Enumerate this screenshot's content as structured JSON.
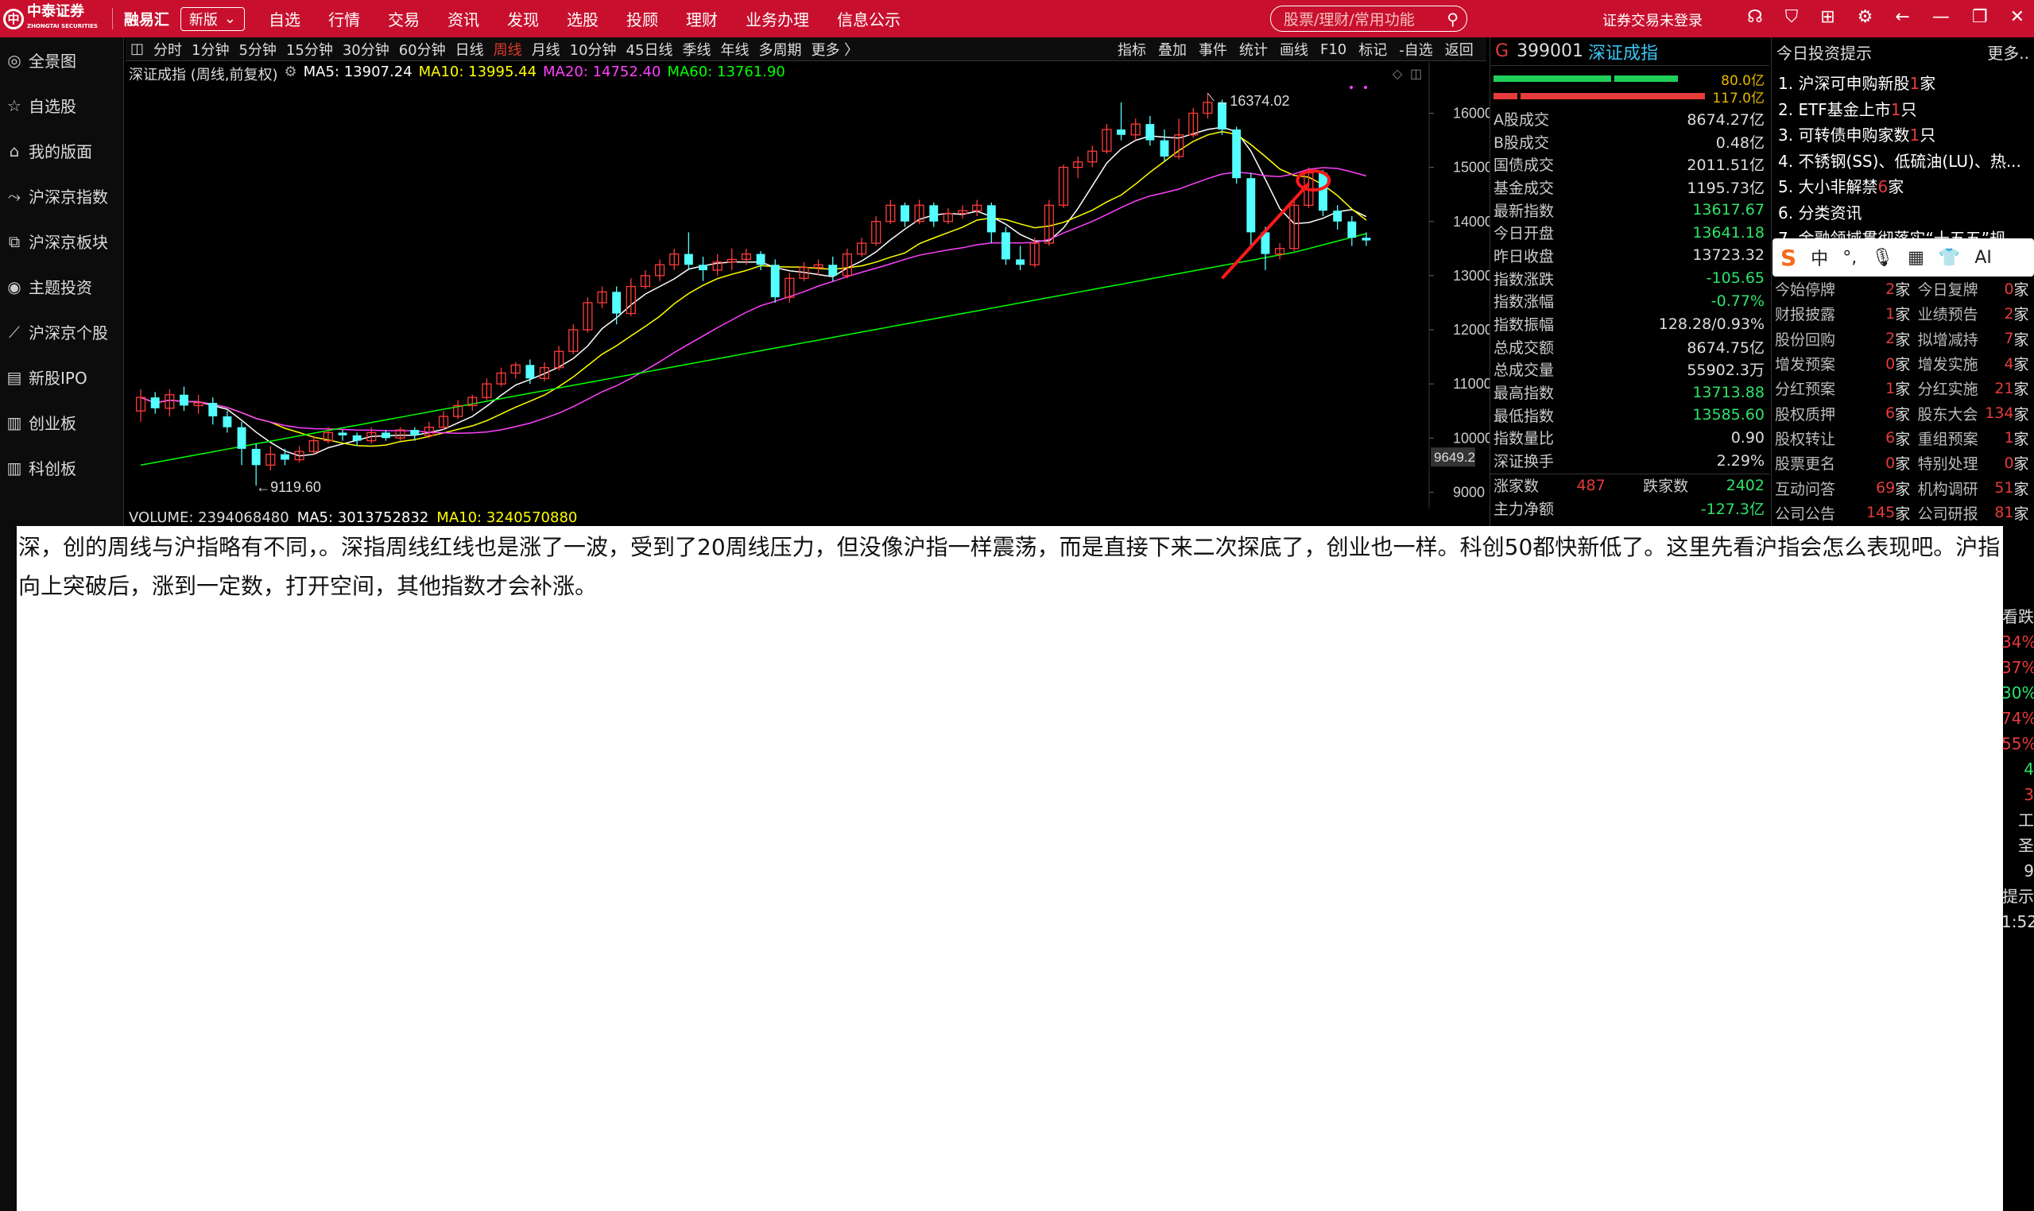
{
  "app": {
    "logo_text": "中泰证券",
    "logo_sub": "ZHONGTAI SECURITIES",
    "brand": "融易汇",
    "version": "新版",
    "menu": [
      "自选",
      "行情",
      "交易",
      "资讯",
      "发现",
      "选股",
      "投顾",
      "理财",
      "业务办理",
      "信息公示"
    ],
    "search_placeholder": "股票/理财/常用功能",
    "login": "证券交易未登录"
  },
  "leftnav": [
    {
      "label": "全景图",
      "icon": "globe-icon"
    },
    {
      "label": "自选股",
      "icon": "star-icon"
    },
    {
      "label": "我的版面",
      "icon": "home-icon"
    },
    {
      "label": "沪深京指数",
      "icon": "trend-icon"
    },
    {
      "label": "沪深京板块",
      "icon": "block-icon"
    },
    {
      "label": "主题投资",
      "icon": "target-icon"
    },
    {
      "label": "沪深京个股",
      "icon": "chart-icon"
    },
    {
      "label": "新股IPO",
      "icon": "calendar-icon"
    },
    {
      "label": "创业板",
      "icon": "board-icon"
    },
    {
      "label": "科创板",
      "icon": "board-icon"
    }
  ],
  "periods": [
    "分时",
    "1分钟",
    "5分钟",
    "15分钟",
    "30分钟",
    "60分钟",
    "日线",
    "周线",
    "月线",
    "10分钟",
    "45日线",
    "季线",
    "年线",
    "多周期",
    "更多 〉"
  ],
  "active_period": "周线",
  "tools": [
    "指标",
    "叠加",
    "事件",
    "统计",
    "画线",
    "F10",
    "标记",
    "-自选",
    "返回"
  ],
  "chart_legend": {
    "name": "深证成指 (周线,前复权)",
    "ma5": "MA5: 13907.24",
    "ma10": "MA10: 13995.44",
    "ma20": "MA20: 14752.40",
    "ma60": "MA60: 13761.90",
    "colors": {
      "ma5": "#ffffff",
      "ma10": "#ffff00",
      "ma20": "#ff40ff",
      "ma60": "#00ff00"
    }
  },
  "volume_legend": {
    "vol": "VOLUME: 2394068480",
    "ma5": "MA5: 3013752832",
    "ma10": "MA10: 3240570880"
  },
  "chart_data": {
    "type": "candlestick",
    "title": "深证成指 (周线,前复权)",
    "y_ticks": [
      16000,
      15000,
      14000,
      13000,
      12000,
      11000,
      10000,
      9000
    ],
    "y_range": [
      8800,
      16800
    ],
    "max_label": "16374.02",
    "min_label": "9119.60",
    "current_tag": "9649.2",
    "candles": [
      [
        10500,
        10750,
        10300,
        10900
      ],
      [
        10750,
        10550,
        10450,
        10850
      ],
      [
        10550,
        10800,
        10400,
        10900
      ],
      [
        10800,
        10600,
        10500,
        10950
      ],
      [
        10600,
        10650,
        10450,
        10800
      ],
      [
        10650,
        10400,
        10250,
        10750
      ],
      [
        10400,
        10200,
        10100,
        10500
      ],
      [
        10200,
        9800,
        9500,
        10300
      ],
      [
        9800,
        9500,
        9119.6,
        9900
      ],
      [
        9500,
        9700,
        9400,
        9850
      ],
      [
        9700,
        9600,
        9500,
        9800
      ],
      [
        9600,
        9750,
        9550,
        9850
      ],
      [
        9750,
        9950,
        9700,
        10050
      ],
      [
        9950,
        10100,
        9900,
        10200
      ],
      [
        10100,
        10050,
        9950,
        10150
      ],
      [
        10050,
        9950,
        9850,
        10100
      ],
      [
        9950,
        10100,
        9900,
        10200
      ],
      [
        10100,
        10000,
        9950,
        10150
      ],
      [
        10000,
        10150,
        9950,
        10200
      ],
      [
        10150,
        10050,
        9950,
        10200
      ],
      [
        10050,
        10200,
        10000,
        10300
      ],
      [
        10200,
        10400,
        10150,
        10500
      ],
      [
        10400,
        10600,
        10350,
        10700
      ],
      [
        10600,
        10750,
        10500,
        10800
      ],
      [
        10750,
        11000,
        10700,
        11100
      ],
      [
        11000,
        11200,
        10950,
        11300
      ],
      [
        11200,
        11350,
        11100,
        11400
      ],
      [
        11350,
        11100,
        11000,
        11450
      ],
      [
        11100,
        11300,
        11050,
        11400
      ],
      [
        11300,
        11600,
        11250,
        11700
      ],
      [
        11600,
        12000,
        11550,
        12100
      ],
      [
        12000,
        12500,
        11950,
        12600
      ],
      [
        12500,
        12700,
        12400,
        12800
      ],
      [
        12700,
        12300,
        12100,
        12800
      ],
      [
        12300,
        12800,
        12250,
        12950
      ],
      [
        12800,
        13000,
        12750,
        13100
      ],
      [
        13000,
        13200,
        12900,
        13300
      ],
      [
        13200,
        13400,
        13100,
        13500
      ],
      [
        13400,
        13200,
        13100,
        13800
      ],
      [
        13200,
        13100,
        12900,
        13350
      ],
      [
        13100,
        13250,
        13000,
        13400
      ],
      [
        13250,
        13300,
        13100,
        13500
      ],
      [
        13300,
        13400,
        13200,
        13500
      ],
      [
        13400,
        13200,
        13100,
        13450
      ],
      [
        13200,
        12600,
        12500,
        13300
      ],
      [
        12600,
        12950,
        12500,
        13050
      ],
      [
        12950,
        13150,
        12900,
        13250
      ],
      [
        13150,
        13200,
        13000,
        13300
      ],
      [
        13200,
        13000,
        12900,
        13350
      ],
      [
        13000,
        13400,
        12950,
        13500
      ],
      [
        13400,
        13600,
        13350,
        13700
      ],
      [
        13600,
        14000,
        13550,
        14100
      ],
      [
        14000,
        14300,
        13950,
        14400
      ],
      [
        14300,
        14000,
        13900,
        14350
      ],
      [
        14000,
        14300,
        13950,
        14400
      ],
      [
        14300,
        14000,
        13900,
        14350
      ],
      [
        14000,
        14150,
        13950,
        14250
      ],
      [
        14150,
        14200,
        14050,
        14300
      ],
      [
        14200,
        14300,
        14100,
        14400
      ],
      [
        14300,
        13800,
        13600,
        14350
      ],
      [
        13800,
        13300,
        13200,
        13900
      ],
      [
        13300,
        13200,
        13100,
        13550
      ],
      [
        13200,
        13600,
        13150,
        13700
      ],
      [
        13600,
        14300,
        13550,
        14400
      ],
      [
        14300,
        15000,
        14250,
        15050
      ],
      [
        15000,
        15100,
        14800,
        15200
      ],
      [
        15100,
        15300,
        15000,
        15400
      ],
      [
        15300,
        15700,
        15250,
        15800
      ],
      [
        15700,
        15600,
        15500,
        16200
      ],
      [
        15600,
        15800,
        15500,
        15900
      ],
      [
        15800,
        15500,
        15400,
        15950
      ],
      [
        15500,
        15200,
        15100,
        15700
      ],
      [
        15200,
        15600,
        15150,
        15900
      ],
      [
        15600,
        16000,
        15550,
        16100
      ],
      [
        16000,
        16200,
        15900,
        16374
      ],
      [
        16200,
        15700,
        15600,
        16250
      ],
      [
        15700,
        14800,
        14700,
        15750
      ],
      [
        14800,
        13800,
        13500,
        14900
      ],
      [
        13800,
        13400,
        13100,
        13900
      ],
      [
        13400,
        13500,
        13300,
        13600
      ],
      [
        13500,
        14300,
        13450,
        14400
      ],
      [
        14300,
        14900,
        14250,
        15000
      ],
      [
        14900,
        14200,
        14100,
        14950
      ],
      [
        14200,
        14000,
        13850,
        14300
      ],
      [
        14000,
        13700,
        13550,
        14100
      ],
      [
        13700,
        13650,
        13550,
        13800
      ]
    ]
  },
  "right_panel": {
    "code": "399001",
    "name": "深证成指",
    "bar1_val": "80.0亿",
    "bar2_val": "117.0亿",
    "rows": [
      {
        "k": "A股成交",
        "v": "8674.27亿",
        "c": "w"
      },
      {
        "k": "B股成交",
        "v": "0.48亿",
        "c": "w"
      },
      {
        "k": "国债成交",
        "v": "2011.51亿",
        "c": "w"
      },
      {
        "k": "基金成交",
        "v": "1195.73亿",
        "c": "w"
      },
      {
        "k": "最新指数",
        "v": "13617.67",
        "c": "g"
      },
      {
        "k": "今日开盘",
        "v": "13641.18",
        "c": "g"
      },
      {
        "k": "昨日收盘",
        "v": "13723.32",
        "c": "w"
      },
      {
        "k": "指数涨跌",
        "v": "-105.65",
        "c": "g"
      },
      {
        "k": "指数涨幅",
        "v": "-0.77%",
        "c": "g"
      },
      {
        "k": "指数振幅",
        "v": "128.28/0.93%",
        "c": "w"
      },
      {
        "k": "总成交额",
        "v": "8674.75亿",
        "c": "w"
      },
      {
        "k": "总成交量",
        "v": "55902.3万",
        "c": "w"
      },
      {
        "k": "最高指数",
        "v": "13713.88",
        "c": "g"
      },
      {
        "k": "最低指数",
        "v": "13585.60",
        "c": "g"
      },
      {
        "k": "指数量比",
        "v": "0.90",
        "c": "w"
      },
      {
        "k": "深证换手",
        "v": "2.29%",
        "c": "w"
      }
    ],
    "up_label": "涨家数",
    "up_val": "487",
    "down_label": "跌家数",
    "down_val": "2402",
    "fund_label": "主力净额",
    "fund_val": "-127.3亿"
  },
  "news": {
    "header": "今日投资提示",
    "more": "更多..",
    "items": [
      {
        "pre": "1. 沪深可申购新股",
        "hl": "1",
        "post": "家"
      },
      {
        "pre": "2. ETF基金上市",
        "hl": "1",
        "post": "只"
      },
      {
        "pre": "3. 可转债申购家数",
        "hl": "1",
        "post": "只"
      },
      {
        "pre": "4. 不锈钢(SS)、低硫油(LU)、热...",
        "hl": "",
        "post": ""
      },
      {
        "pre": "5. 大小非解禁",
        "hl": "6",
        "post": "家"
      },
      {
        "pre": "6. 分类资讯",
        "hl": "",
        "post": ""
      },
      {
        "pre": "7. 金融领域贯彻落实“十五五”规",
        "hl": "",
        "post": ""
      }
    ],
    "stats": [
      {
        "a": "今始停牌",
        "an": "2",
        "b": "今日复牌",
        "bn": "0"
      },
      {
        "a": "财报披露",
        "an": "1",
        "b": "业绩预告",
        "bn": "2"
      },
      {
        "a": "股份回购",
        "an": "2",
        "b": "拟增减持",
        "bn": "7"
      },
      {
        "a": "增发预案",
        "an": "0",
        "b": "增发实施",
        "bn": "4"
      },
      {
        "a": "分红预案",
        "an": "1",
        "b": "分红实施",
        "bn": "21"
      },
      {
        "a": "股权质押",
        "an": "6",
        "b": "股东大会",
        "bn": "134"
      },
      {
        "a": "股权转让",
        "an": "6",
        "b": "重组预案",
        "bn": "1"
      },
      {
        "a": "股票更名",
        "an": "0",
        "b": "特别处理",
        "bn": "0"
      },
      {
        "a": "互动问答",
        "an": "69",
        "b": "机构调研",
        "bn": "51"
      },
      {
        "a": "公司公告",
        "an": "145",
        "b": "公司研报",
        "bn": "81"
      }
    ],
    "unit": "家"
  },
  "ime": {
    "items": [
      "中",
      "°,",
      "🎙",
      "▦",
      "👕",
      "AI"
    ]
  },
  "overlay_text": "深，创的周线与沪指略有不同，。深指周线红线也是涨了一波，受到了20周线压力，但没像沪指一样震荡，而是直接下来二次探底了，创业也一样。科创50都快新低了。这里先看沪指会怎么表现吧。沪指向上突破后，涨到一定数，打开空间，其他指数才会补涨。",
  "edge_fragments": [
    "看跌",
    "34%",
    "37%",
    "30%",
    "74%",
    "55%",
    "4",
    "3",
    "工",
    "圣",
    "9",
    "提示",
    "1:52"
  ]
}
